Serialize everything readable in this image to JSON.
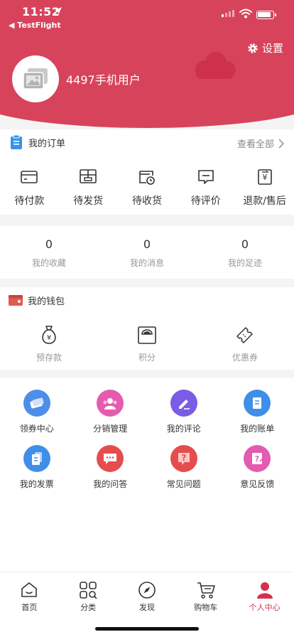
{
  "status_bar": {
    "time": "11:52",
    "back_app": "◀ TestFlight"
  },
  "header": {
    "settings_label": "设置",
    "username": "4497手机用户"
  },
  "orders": {
    "title": "我的订单",
    "view_all": "查看全部",
    "items": [
      {
        "label": "待付款",
        "icon": "wallet-icon"
      },
      {
        "label": "待发货",
        "icon": "package-icon"
      },
      {
        "label": "待收货",
        "icon": "delivery-clock-icon"
      },
      {
        "label": "待评价",
        "icon": "comment-icon"
      },
      {
        "label": "退款/售后",
        "icon": "refund-icon"
      }
    ]
  },
  "stats": [
    {
      "value": "0",
      "label": "我的收藏"
    },
    {
      "value": "0",
      "label": "我的消息"
    },
    {
      "value": "0",
      "label": "我的足迹"
    }
  ],
  "wallet": {
    "title": "我的钱包",
    "items": [
      {
        "label": "预存款",
        "icon": "money-bag-icon"
      },
      {
        "label": "积分",
        "icon": "points-icon"
      },
      {
        "label": "优惠券",
        "icon": "coupon-icon"
      }
    ]
  },
  "services": [
    {
      "label": "领券中心",
      "icon": "coupon-center-icon",
      "color": "#4d8ee8"
    },
    {
      "label": "分销管理",
      "icon": "distribution-icon",
      "color": "#e45bb0"
    },
    {
      "label": "我的评论",
      "icon": "pen-icon",
      "color": "#7a5ce6"
    },
    {
      "label": "我的账单",
      "icon": "bill-icon",
      "color": "#3f8ee8"
    },
    {
      "label": "我的发票",
      "icon": "invoice-icon",
      "color": "#3f8ee8"
    },
    {
      "label": "我的问答",
      "icon": "chat-icon",
      "color": "#e54d4d"
    },
    {
      "label": "常见问题",
      "icon": "question-icon",
      "color": "#e54d4d"
    },
    {
      "label": "意见反馈",
      "icon": "feedback-icon",
      "color": "#e45bb0"
    }
  ],
  "tabbar": [
    {
      "label": "首页",
      "icon": "home-icon"
    },
    {
      "label": "分类",
      "icon": "category-icon"
    },
    {
      "label": "发现",
      "icon": "compass-icon"
    },
    {
      "label": "购物车",
      "icon": "cart-icon"
    },
    {
      "label": "个人中心",
      "icon": "profile-icon",
      "active": true
    }
  ],
  "colors": {
    "brand": "#d8435c",
    "active_tab": "#d5314b"
  }
}
